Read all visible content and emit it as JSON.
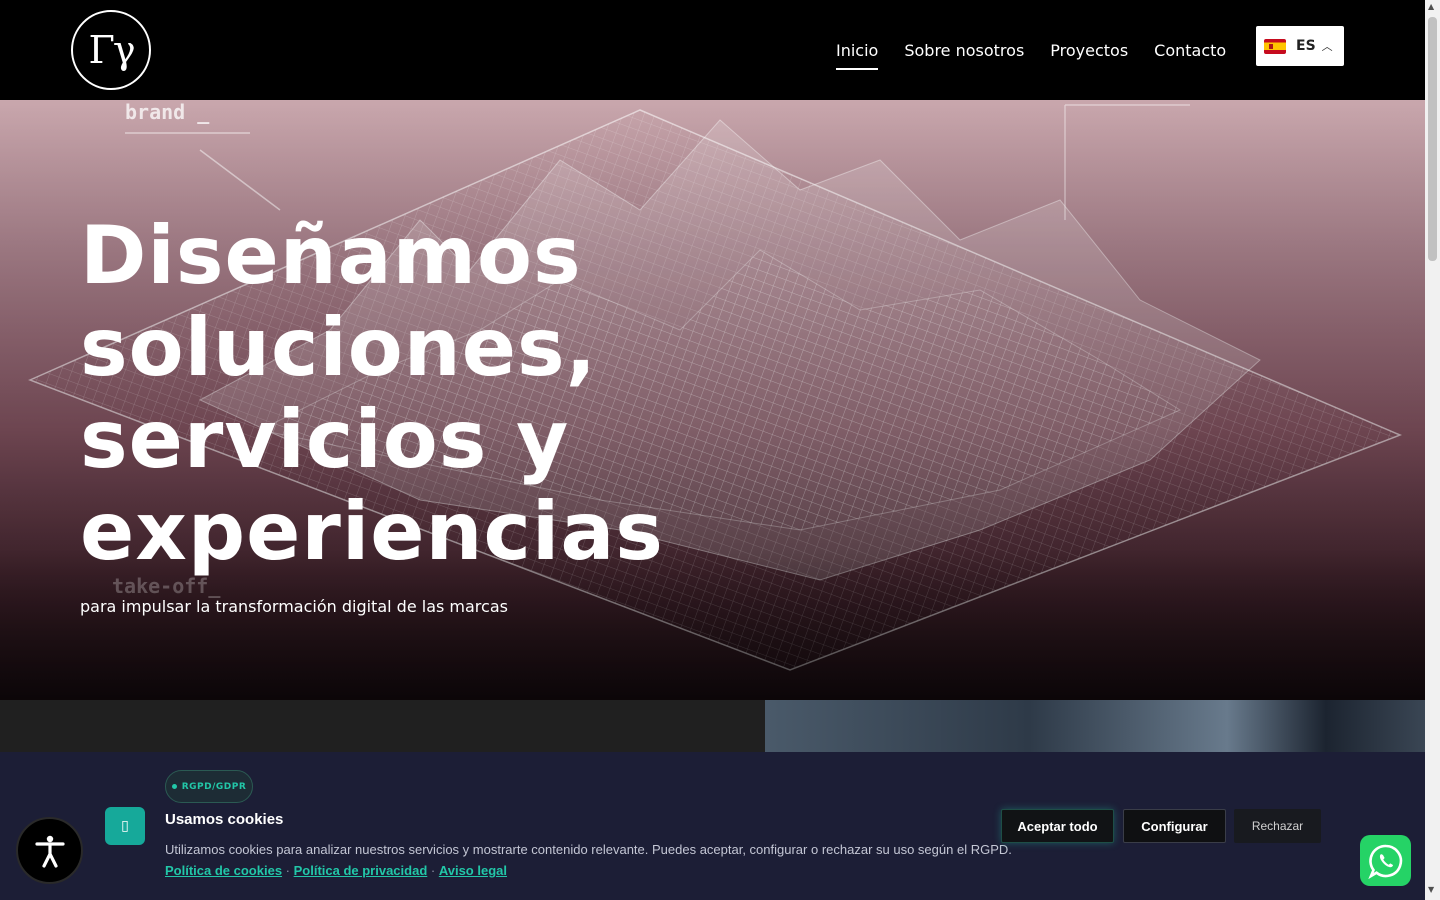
{
  "header": {
    "logo_text": "Γγ",
    "nav": [
      {
        "label": "Inicio",
        "active": true
      },
      {
        "label": "Sobre nosotros",
        "active": false
      },
      {
        "label": "Proyectos",
        "active": false
      },
      {
        "label": "Contacto",
        "active": false
      }
    ],
    "language": {
      "code": "ES",
      "flag": "spain-flag-icon"
    }
  },
  "hero": {
    "title_lines": [
      "Diseñamos",
      "soluciones,",
      "servicios y",
      "experiencias"
    ],
    "subtitle": "para impulsar la transformación digital de las marcas",
    "background_tags": {
      "brand": "brand _",
      "takeoff": "take-off_"
    }
  },
  "cookie_banner": {
    "badge": "RGPD/GDPR",
    "icon": "cookie-icon",
    "title": "Usamos cookies",
    "text": "Utilizamos cookies para analizar nuestros servicios y mostrarte contenido relevante. Puedes aceptar, configurar o rechazar su uso según el RGPD.",
    "links": [
      "Política de cookies",
      "Política de privacidad",
      "Aviso legal"
    ],
    "link_separator": " · ",
    "buttons": {
      "accept": "Aceptar todo",
      "configure": "Configurar",
      "reject": "Rechazar"
    },
    "accent_color": "#22c7a8",
    "background_color": "#1c1e36"
  },
  "floating": {
    "accessibility": "accessibility-icon",
    "whatsapp": "whatsapp-icon"
  }
}
